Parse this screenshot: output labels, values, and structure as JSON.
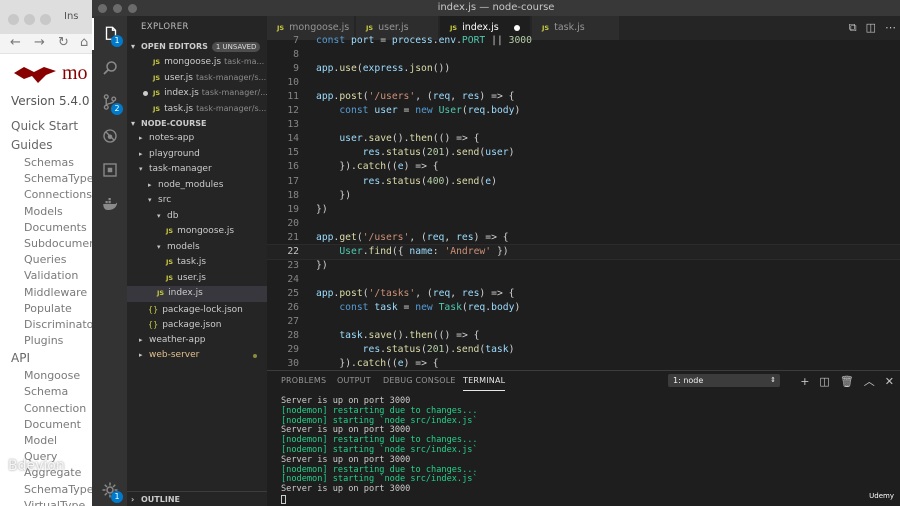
{
  "browser": {
    "tab_title": "Ins",
    "logo_text": "mo",
    "version": "Version 5.4.0",
    "nav": [
      {
        "label": "Quick Start",
        "level": "h"
      },
      {
        "label": "Guides",
        "level": "h"
      },
      {
        "label": "Schemas",
        "level": "s"
      },
      {
        "label": "SchemaTypes",
        "level": "s"
      },
      {
        "label": "Connections",
        "level": "s"
      },
      {
        "label": "Models",
        "level": "s"
      },
      {
        "label": "Documents",
        "level": "s"
      },
      {
        "label": "Subdocuments",
        "level": "s"
      },
      {
        "label": "Queries",
        "level": "s"
      },
      {
        "label": "Validation",
        "level": "s"
      },
      {
        "label": "Middleware",
        "level": "s"
      },
      {
        "label": "Populate",
        "level": "s"
      },
      {
        "label": "Discriminators",
        "level": "s"
      },
      {
        "label": "Plugins",
        "level": "s"
      },
      {
        "label": "API",
        "level": "h"
      },
      {
        "label": "Mongoose",
        "level": "s"
      },
      {
        "label": "Schema",
        "level": "s"
      },
      {
        "label": "Connection",
        "level": "s"
      },
      {
        "label": "Document",
        "level": "s"
      },
      {
        "label": "Model",
        "level": "s"
      },
      {
        "label": "Query",
        "level": "s"
      },
      {
        "label": "Aggregate",
        "level": "s"
      },
      {
        "label": "SchemaType",
        "level": "s"
      },
      {
        "label": "VirtualType",
        "level": "s"
      }
    ],
    "watermark": "Bdevion"
  },
  "window": {
    "title": "index.js — node-course"
  },
  "activity": {
    "explorer_badge": "1",
    "scm_badge": "2",
    "settings_badge": "1"
  },
  "sidebar": {
    "title": "EXPLORER",
    "open_editors_label": "OPEN EDITORS",
    "unsaved_badge": "1 UNSAVED",
    "open_editors": [
      {
        "name": "mongoose.js",
        "path": "task-ma..."
      },
      {
        "name": "user.js",
        "path": "task-manager/s..."
      },
      {
        "name": "index.js",
        "path": "task-manager/..."
      },
      {
        "name": "task.js",
        "path": "task-manager/s..."
      }
    ],
    "project_label": "NODE-COURSE",
    "tree": [
      {
        "name": "notes-app",
        "kind": "folder",
        "depth": 0,
        "open": false
      },
      {
        "name": "playground",
        "kind": "folder",
        "depth": 0,
        "open": false
      },
      {
        "name": "task-manager",
        "kind": "folder",
        "depth": 0,
        "open": true
      },
      {
        "name": "node_modules",
        "kind": "folder",
        "depth": 1,
        "open": false
      },
      {
        "name": "src",
        "kind": "folder",
        "depth": 1,
        "open": true
      },
      {
        "name": "db",
        "kind": "folder",
        "depth": 2,
        "open": true
      },
      {
        "name": "mongoose.js",
        "kind": "js",
        "depth": 3
      },
      {
        "name": "models",
        "kind": "folder",
        "depth": 2,
        "open": true
      },
      {
        "name": "task.js",
        "kind": "js",
        "depth": 3
      },
      {
        "name": "user.js",
        "kind": "js",
        "depth": 3
      },
      {
        "name": "index.js",
        "kind": "js",
        "depth": 2,
        "selected": true
      },
      {
        "name": "package-lock.json",
        "kind": "json",
        "depth": 1
      },
      {
        "name": "package.json",
        "kind": "json",
        "depth": 1
      },
      {
        "name": "weather-app",
        "kind": "folder",
        "depth": 0,
        "open": false
      },
      {
        "name": "web-server",
        "kind": "folder",
        "depth": 0,
        "open": false,
        "modified": true
      }
    ],
    "outline_label": "OUTLINE"
  },
  "tabs": [
    {
      "name": "mongoose.js",
      "active": false
    },
    {
      "name": "user.js",
      "active": false
    },
    {
      "name": "index.js",
      "active": true,
      "modified": true
    },
    {
      "name": "task.js",
      "active": false
    }
  ],
  "code": {
    "current_line": 22,
    "lines": [
      {
        "n": 7,
        "t": "const port = process.env.PORT || 3000"
      },
      {
        "n": 8,
        "t": ""
      },
      {
        "n": 9,
        "t": "app.use(express.json())"
      },
      {
        "n": 10,
        "t": ""
      },
      {
        "n": 11,
        "t": "app.post('/users', (req, res) => {"
      },
      {
        "n": 12,
        "t": "    const user = new User(req.body)"
      },
      {
        "n": 13,
        "t": ""
      },
      {
        "n": 14,
        "t": "    user.save().then(() => {"
      },
      {
        "n": 15,
        "t": "        res.status(201).send(user)"
      },
      {
        "n": 16,
        "t": "    }).catch((e) => {"
      },
      {
        "n": 17,
        "t": "        res.status(400).send(e)"
      },
      {
        "n": 18,
        "t": "    })"
      },
      {
        "n": 19,
        "t": "})"
      },
      {
        "n": 20,
        "t": ""
      },
      {
        "n": 21,
        "t": "app.get('/users', (req, res) => {"
      },
      {
        "n": 22,
        "t": "    User.find({ name: 'Andrew' })"
      },
      {
        "n": 23,
        "t": "})"
      },
      {
        "n": 24,
        "t": ""
      },
      {
        "n": 25,
        "t": "app.post('/tasks', (req, res) => {"
      },
      {
        "n": 26,
        "t": "    const task = new Task(req.body)"
      },
      {
        "n": 27,
        "t": ""
      },
      {
        "n": 28,
        "t": "    task.save().then(() => {"
      },
      {
        "n": 29,
        "t": "        res.status(201).send(task)"
      },
      {
        "n": 30,
        "t": "    }).catch((e) => {"
      }
    ]
  },
  "panel": {
    "tabs": [
      "PROBLEMS",
      "OUTPUT",
      "DEBUG CONSOLE",
      "TERMINAL"
    ],
    "active_tab": "TERMINAL",
    "terminal_select": "1: node",
    "lines": [
      {
        "t": "Server is up on port 3000",
        "c": "w"
      },
      {
        "t": "[nodemon] restarting due to changes...",
        "c": "g"
      },
      {
        "t": "[nodemon] starting `node src/index.js`",
        "c": "g"
      },
      {
        "t": "Server is up on port 3000",
        "c": "w"
      },
      {
        "t": "[nodemon] restarting due to changes...",
        "c": "g"
      },
      {
        "t": "[nodemon] starting `node src/index.js`",
        "c": "g"
      },
      {
        "t": "Server is up on port 3000",
        "c": "w"
      },
      {
        "t": "[nodemon] restarting due to changes...",
        "c": "g"
      },
      {
        "t": "[nodemon] starting `node src/index.js`",
        "c": "g"
      },
      {
        "t": "Server is up on port 3000",
        "c": "w"
      }
    ],
    "watermark": "Udemy"
  },
  "colors": {
    "accent": "#007acc",
    "terminal_green": "#23d18b",
    "js_yellow": "#cbcb41"
  }
}
